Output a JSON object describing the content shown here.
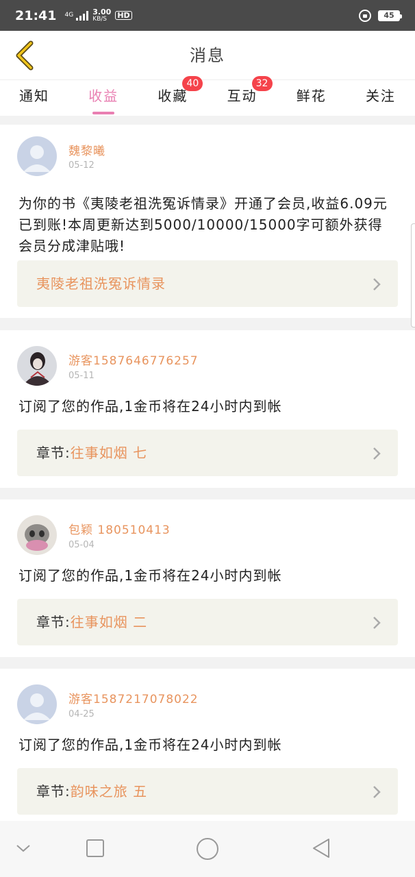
{
  "status_bar": {
    "time": "21:41",
    "network": "4G",
    "speed_value": "3.00",
    "speed_unit": "KB/S",
    "hd": "HD",
    "battery": "45"
  },
  "header": {
    "title": "消息",
    "back_icon": "chevron-left-icon",
    "accent_color": "#f0c419"
  },
  "tabs": [
    {
      "label": "通知",
      "active": false
    },
    {
      "label": "收益",
      "active": true
    },
    {
      "label": "收藏",
      "badge": "40"
    },
    {
      "label": "互动",
      "badge": "32"
    },
    {
      "label": "鲜花"
    },
    {
      "label": "关注"
    }
  ],
  "messages": [
    {
      "user": "魏黎曦",
      "date": "05-12",
      "text": "为你的书《夷陵老祖洗冤诉情录》开通了会员,收益6.09元已到账!本周更新达到5000/10000/15000字可额外获得会员分成津贴哦!",
      "link_prefix": "",
      "link_value": "夷陵老祖洗冤诉情录"
    },
    {
      "user": "游客1587646776257",
      "date": "05-11",
      "text": "订阅了您的作品,1金币将在24小时内到帐",
      "link_prefix": "章节:",
      "link_value": "往事如烟 七"
    },
    {
      "user": "包颖 180510413",
      "date": "05-04",
      "text": "订阅了您的作品,1金币将在24小时内到帐",
      "link_prefix": "章节:",
      "link_value": "往事如烟  二"
    },
    {
      "user": "游客1587217078022",
      "date": "04-25",
      "text": "订阅了您的作品,1金币将在24小时内到帐",
      "link_prefix": "章节:",
      "link_value": "韵味之旅 五"
    }
  ],
  "colors": {
    "tab_active": "#e97fb2",
    "name": "#e8945e",
    "badge": "#f5434b",
    "link_bg": "#f3f3ec"
  },
  "nav_bar": [
    "chevron-down-icon",
    "square-icon",
    "circle-icon",
    "triangle-back-icon"
  ]
}
